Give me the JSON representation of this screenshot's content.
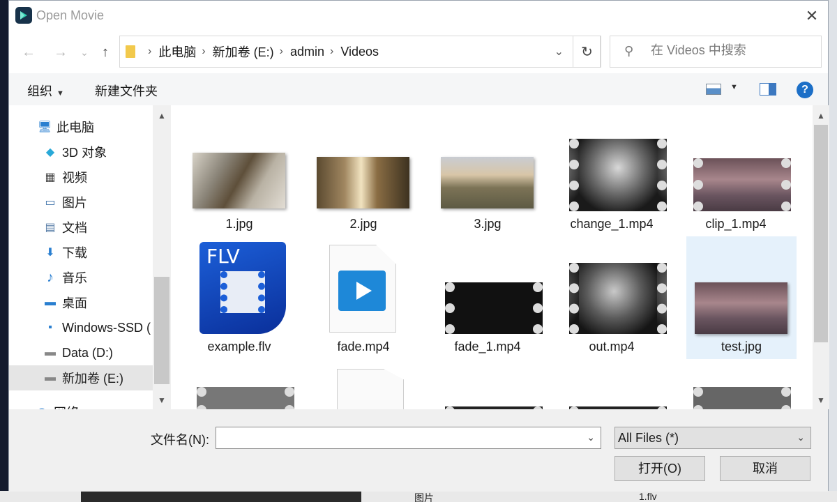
{
  "window": {
    "title": "Open Movie",
    "close_glyph": "✕"
  },
  "nav": {
    "back": "←",
    "forward": "→",
    "recent": "⌄",
    "up": "↑"
  },
  "address": {
    "crumbs": [
      "此电脑",
      "新加卷 (E:)",
      "admin",
      "Videos"
    ],
    "refresh": "↻",
    "search_placeholder": "在 Videos 中搜索"
  },
  "toolbar": {
    "organize": "组织",
    "new_folder": "新建文件夹",
    "help": "?"
  },
  "sidebar": {
    "items": [
      {
        "label": "此电脑",
        "icon": "computer-icon",
        "glyph": "🖥"
      },
      {
        "label": "3D 对象",
        "icon": "cube-icon",
        "glyph": "◆"
      },
      {
        "label": "视频",
        "icon": "film-icon",
        "glyph": "▦"
      },
      {
        "label": "图片",
        "icon": "picture-icon",
        "glyph": "▭"
      },
      {
        "label": "文档",
        "icon": "document-icon",
        "glyph": "▤"
      },
      {
        "label": "下载",
        "icon": "download-icon",
        "glyph": "⬇"
      },
      {
        "label": "音乐",
        "icon": "music-icon",
        "glyph": "♪"
      },
      {
        "label": "桌面",
        "icon": "desktop-icon",
        "glyph": "▬"
      },
      {
        "label": "Windows-SSD (",
        "icon": "windows-drive-icon",
        "glyph": "▪"
      },
      {
        "label": "Data (D:)",
        "icon": "drive-icon",
        "glyph": "▬"
      },
      {
        "label": "新加卷 (E:)",
        "icon": "drive-icon",
        "glyph": "▬"
      },
      {
        "label": "网络",
        "icon": "network-icon",
        "glyph": "◎"
      }
    ]
  },
  "files": [
    {
      "name": "1.jpg",
      "kind": "photo"
    },
    {
      "name": "2.jpg",
      "kind": "photo"
    },
    {
      "name": "3.jpg",
      "kind": "photo"
    },
    {
      "name": "change_1.mp4",
      "kind": "video"
    },
    {
      "name": "clip_1.mp4",
      "kind": "video"
    },
    {
      "name": "example.flv",
      "kind": "flv"
    },
    {
      "name": "fade.mp4",
      "kind": "mp4-doc"
    },
    {
      "name": "fade_1.mp4",
      "kind": "video"
    },
    {
      "name": "out.mp4",
      "kind": "video"
    },
    {
      "name": "test.jpg",
      "kind": "photo",
      "selected": true
    }
  ],
  "flv_badge": "FLV",
  "bottom": {
    "filename_label": "文件名(N):",
    "filename_value": "",
    "filetype_value": "All Files (*)",
    "open_button": "打开(O)",
    "cancel_button": "取消"
  },
  "behind": {
    "folder_label": "图片",
    "file_label": "1.flv"
  },
  "colors": {
    "accent": "#1c6fc7",
    "selection": "#e5f1fb"
  }
}
